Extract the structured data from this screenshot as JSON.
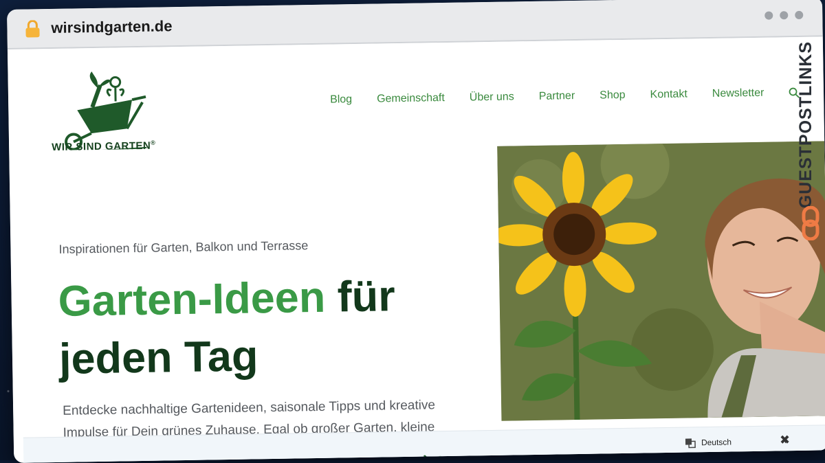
{
  "browser": {
    "url": "wirsindgarten.de"
  },
  "site": {
    "logo_text": "WIR SIND GARTEN",
    "logo_mark": "®",
    "nav": [
      {
        "label": "Blog"
      },
      {
        "label": "Gemeinschaft"
      },
      {
        "label": "Über uns"
      },
      {
        "label": "Partner"
      },
      {
        "label": "Shop"
      },
      {
        "label": "Kontakt"
      },
      {
        "label": "Newsletter"
      }
    ]
  },
  "hero": {
    "eyebrow": "Inspirationen für Garten, Balkon und Terrasse",
    "headline_green": "Garten-Ideen",
    "headline_dark": " für jeden Tag",
    "intro": "Entdecke nachhaltige Gartenideen, saisonale Tipps und kreative Impulse für Dein grünes Zuhause. Egal ob großer Garten, kleine"
  },
  "banner": {
    "language": "Deutsch"
  },
  "watermark": {
    "text": "GUESTPOSTLINKS"
  },
  "colors": {
    "brand_green": "#3a9a46",
    "dark_green": "#12381b",
    "nav_green": "#3a8a3e"
  }
}
